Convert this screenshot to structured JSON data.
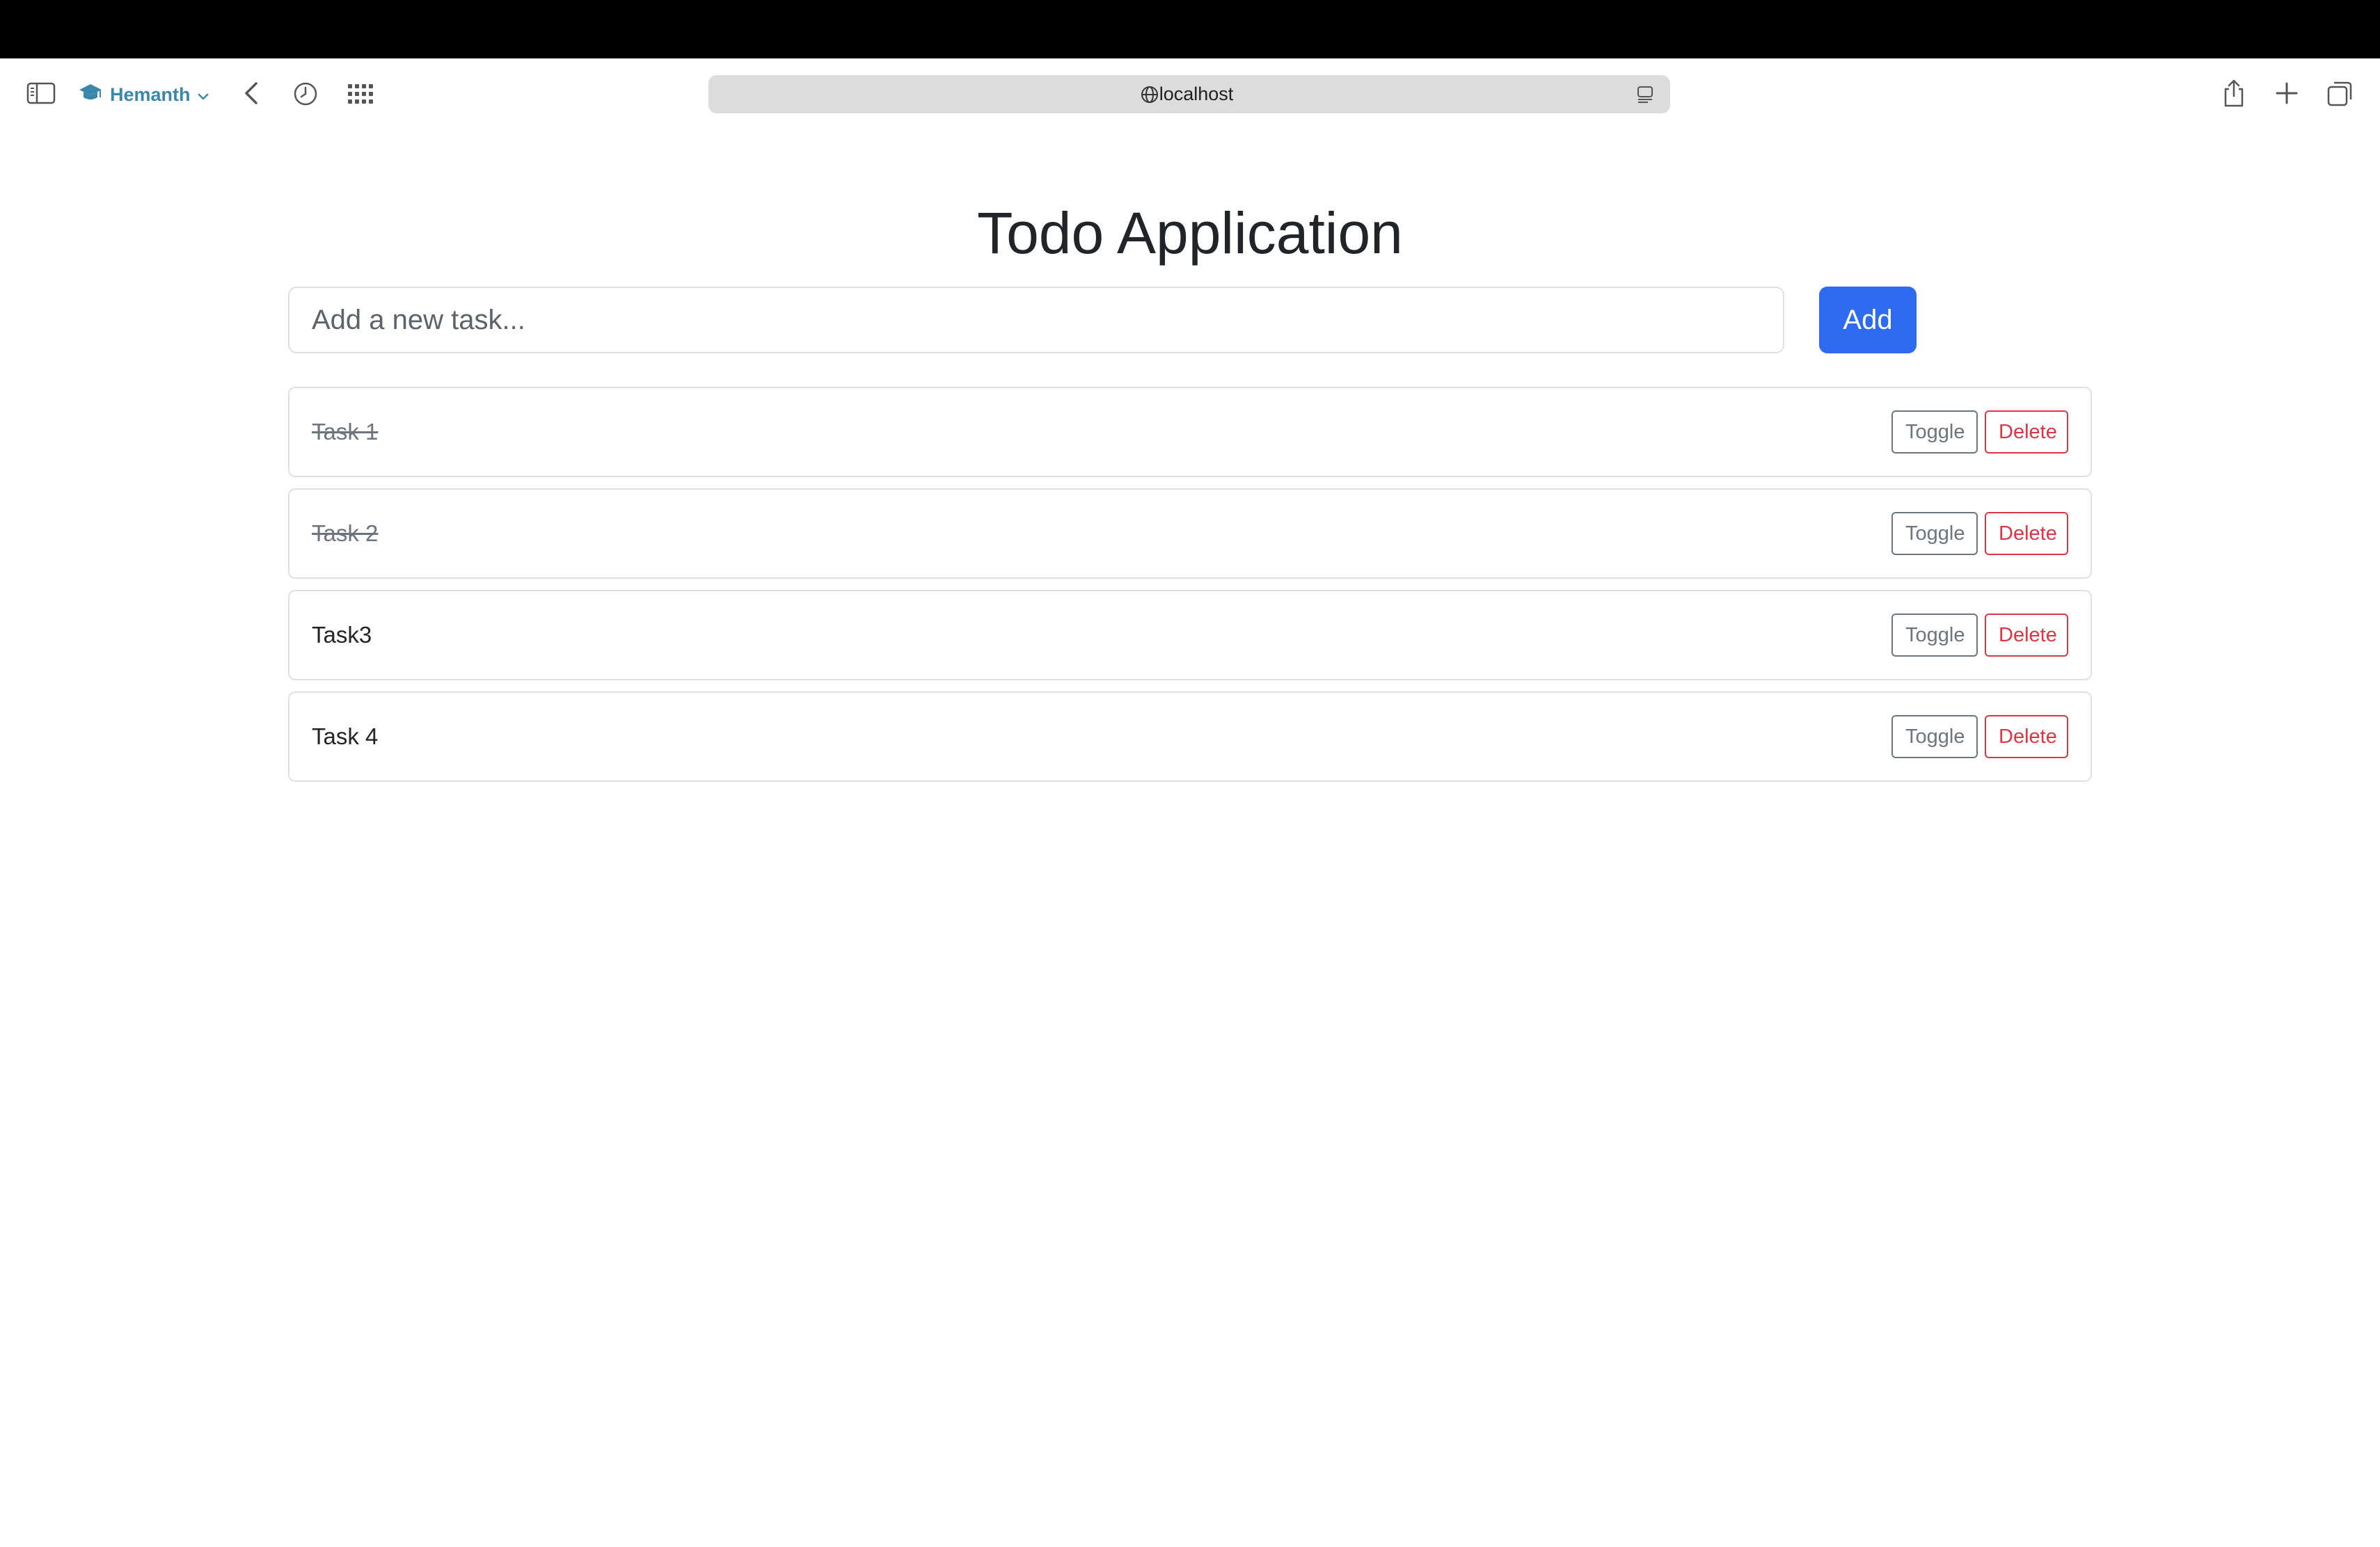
{
  "browser": {
    "profile_name": "Hemanth",
    "url": "localhost",
    "icons": [
      "sidebar-icon",
      "graduation-cap-icon",
      "chevron-down-icon",
      "back-icon",
      "history-icon",
      "grid-icon",
      "globe-icon",
      "reader-icon",
      "share-icon",
      "plus-icon",
      "tabs-icon"
    ]
  },
  "app": {
    "title": "Todo Application",
    "input_placeholder": "Add a new task...",
    "input_value": "",
    "add_label": "Add",
    "tasks": [
      {
        "label": "Task 1",
        "completed": true,
        "toggle_label": "Toggle",
        "delete_label": "Delete"
      },
      {
        "label": "Task 2",
        "completed": true,
        "toggle_label": "Toggle",
        "delete_label": "Delete"
      },
      {
        "label": "Task3",
        "completed": false,
        "toggle_label": "Toggle",
        "delete_label": "Delete"
      },
      {
        "label": "Task 4",
        "completed": false,
        "toggle_label": "Toggle",
        "delete_label": "Delete"
      }
    ]
  },
  "colors": {
    "primary": "#2f6bf0",
    "danger": "#dc3545",
    "secondary": "#6c757d",
    "profile": "#3b86ad"
  }
}
